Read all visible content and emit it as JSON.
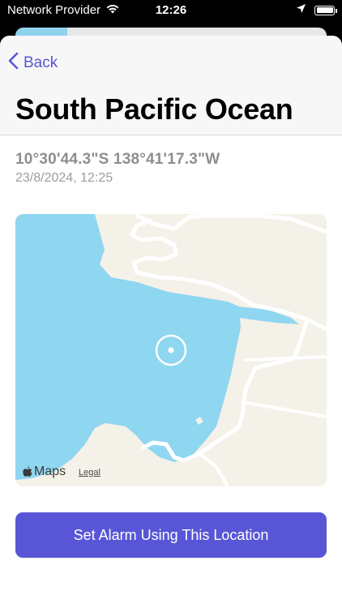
{
  "status_bar": {
    "carrier": "Network Provider",
    "time": "12:26",
    "wifi_icon": "wifi-icon",
    "location_icon": "location-arrow-icon",
    "battery_icon": "battery-full-icon"
  },
  "nav": {
    "back_label": "Back",
    "back_icon": "chevron-left-icon",
    "title": "South Pacific Ocean"
  },
  "location": {
    "coordinates": "10°30'44.3\"S  138°41'17.3\"W",
    "timestamp": "23/8/2024, 12:25"
  },
  "map": {
    "attribution": "Maps",
    "attribution_icon": "apple-logo-icon",
    "legal_label": "Legal",
    "pin_icon": "location-pin-icon"
  },
  "actions": {
    "set_alarm_label": "Set Alarm Using This Location"
  },
  "colors": {
    "accent": "#5856d6",
    "water": "#8fd6f0",
    "land": "#f4f1e8"
  }
}
